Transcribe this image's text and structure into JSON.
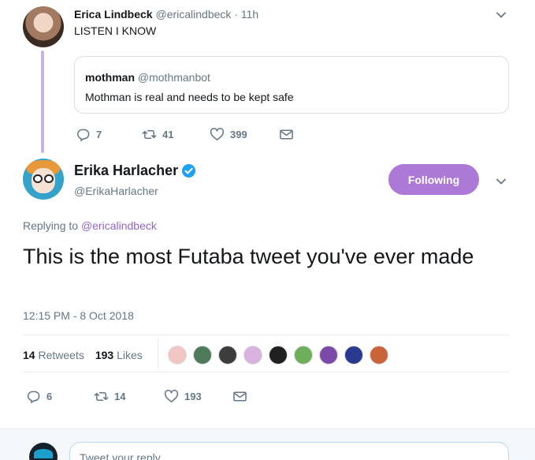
{
  "parent_tweet": {
    "author_name": "Erica Lindbeck",
    "author_handle": "@ericalindbeck",
    "separator": "·",
    "age": "11h",
    "text": "LISTEN I KNOW",
    "quoted": {
      "author_name": "mothman",
      "author_handle": "@mothmanbot",
      "text": "Mothman is real and needs to be kept safe"
    },
    "actions": {
      "replies": "7",
      "retweets": "41",
      "likes": "399"
    }
  },
  "main_tweet": {
    "author_name": "Erika Harlacher",
    "author_handle": "@ErikaHarlacher",
    "verified": true,
    "follow_label": "Following",
    "replying_prefix": "Replying to",
    "replying_to": "@ericalindbeck",
    "text": "This is the most Futaba tweet you've ever made",
    "timestamp": "12:15 PM - 8 Oct 2018",
    "stats": {
      "retweets_count": "14",
      "retweets_label": "Retweets",
      "likes_count": "193",
      "likes_label": "Likes"
    },
    "liker_avatar_colors": [
      "#f3c6c6",
      "#4f7a5a",
      "#3d3d3d",
      "#d9b2e0",
      "#202020",
      "#6fae5a",
      "#7b4aa8",
      "#2a3b8f",
      "#c9643a"
    ],
    "actions": {
      "replies": "6",
      "retweets": "14",
      "likes": "193"
    }
  },
  "reply_box": {
    "placeholder": "Tweet your reply"
  },
  "colors": {
    "accent": "#ac7ad6",
    "verified": "#1da1f2",
    "thread_line": "#c7b3e6",
    "link": "#9266cc"
  },
  "icons": {
    "reply": "reply-icon",
    "retweet": "retweet-icon",
    "like": "heart-icon",
    "dm": "envelope-icon",
    "menu": "chevron-down-icon",
    "verified": "verified-badge-icon"
  }
}
